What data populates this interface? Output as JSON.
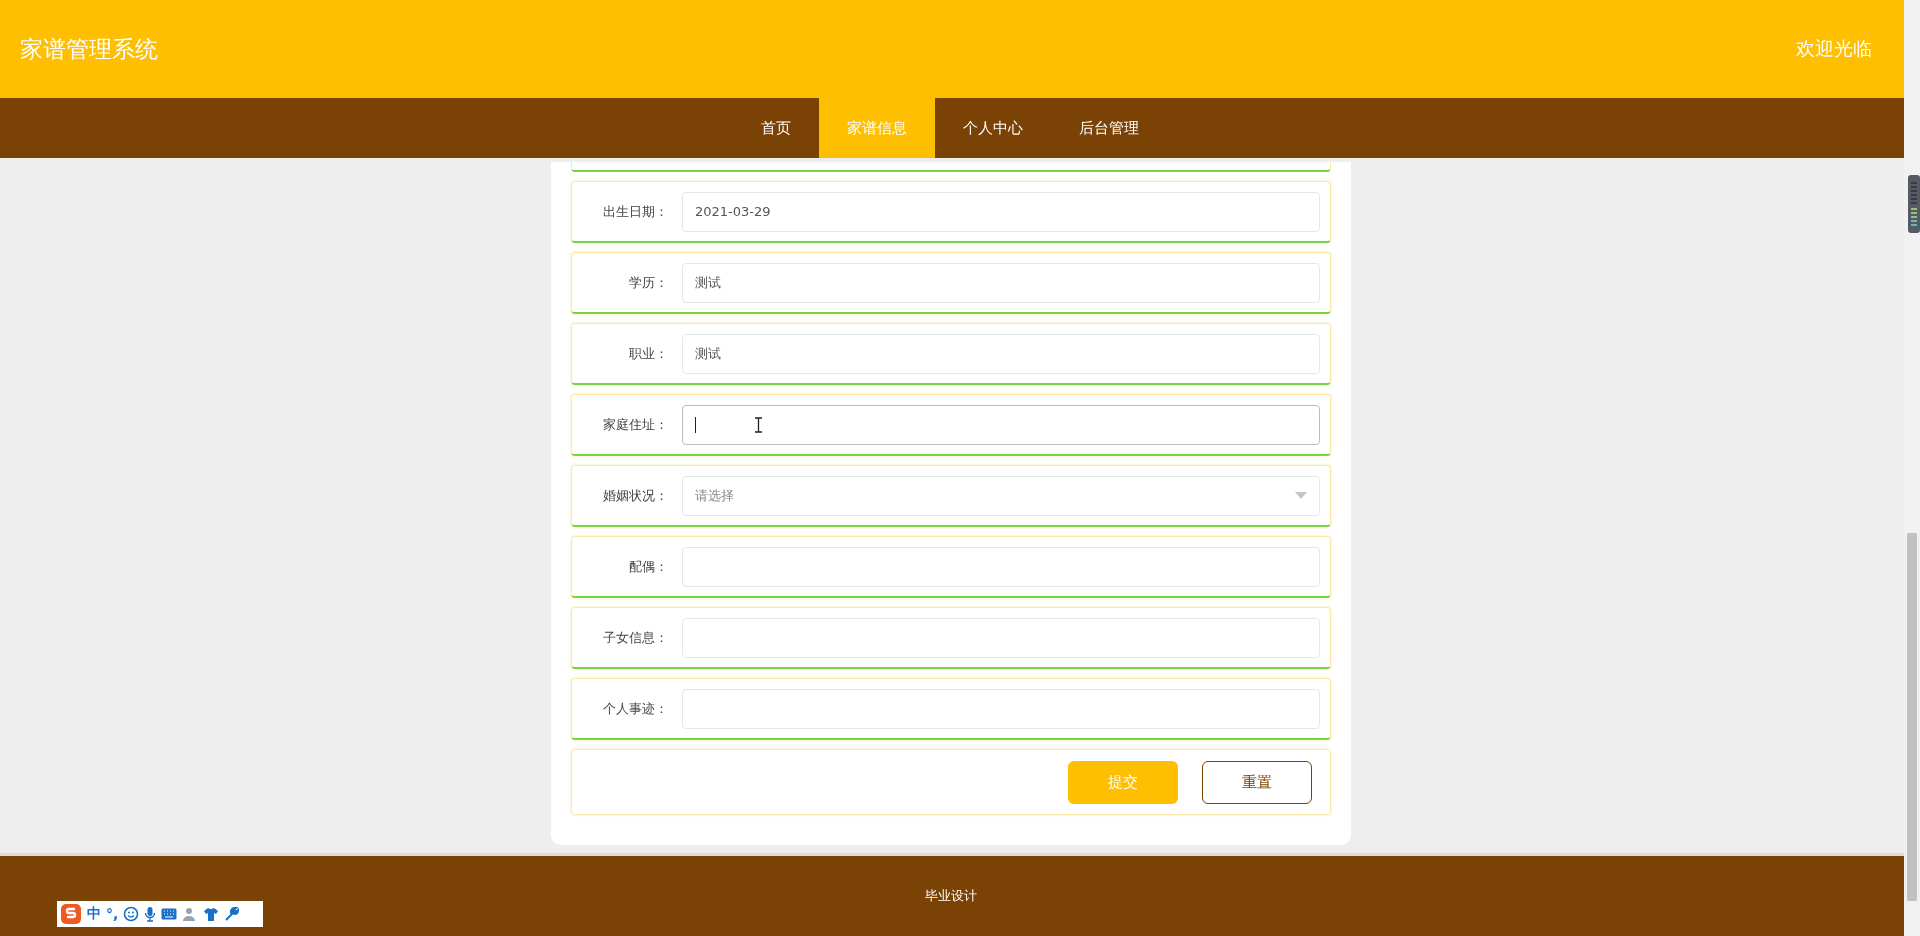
{
  "header": {
    "title": "家谱管理系统",
    "welcome": "欢迎光临"
  },
  "nav": [
    {
      "label": "首页",
      "selected": false
    },
    {
      "label": "家谱信息",
      "selected": true
    },
    {
      "label": "个人中心",
      "selected": false
    },
    {
      "label": "后台管理",
      "selected": false
    }
  ],
  "form": {
    "fields": [
      {
        "kind": "input",
        "label": "出生日期：",
        "value": "2021-03-29",
        "focused": false
      },
      {
        "kind": "input",
        "label": "学历：",
        "value": "测试",
        "focused": false
      },
      {
        "kind": "input",
        "label": "职业：",
        "value": "测试",
        "focused": false
      },
      {
        "kind": "input",
        "label": "家庭住址：",
        "focused": true
      },
      {
        "kind": "select",
        "label": "婚姻状况：",
        "placeholder": "请选择",
        "focused": false
      },
      {
        "kind": "input",
        "label": "配偶：",
        "focused": false
      },
      {
        "kind": "input",
        "label": "子女信息：",
        "focused": false
      },
      {
        "kind": "input",
        "label": "个人事迹：",
        "focused": false
      }
    ],
    "buttons": [
      {
        "label": "提交",
        "kind": "primary"
      },
      {
        "label": "重置",
        "kind": "outline"
      }
    ]
  },
  "footer": {
    "text": "毕业设计"
  },
  "ime_toolbar": {
    "mode": "中",
    "punctuation": "°,"
  }
}
